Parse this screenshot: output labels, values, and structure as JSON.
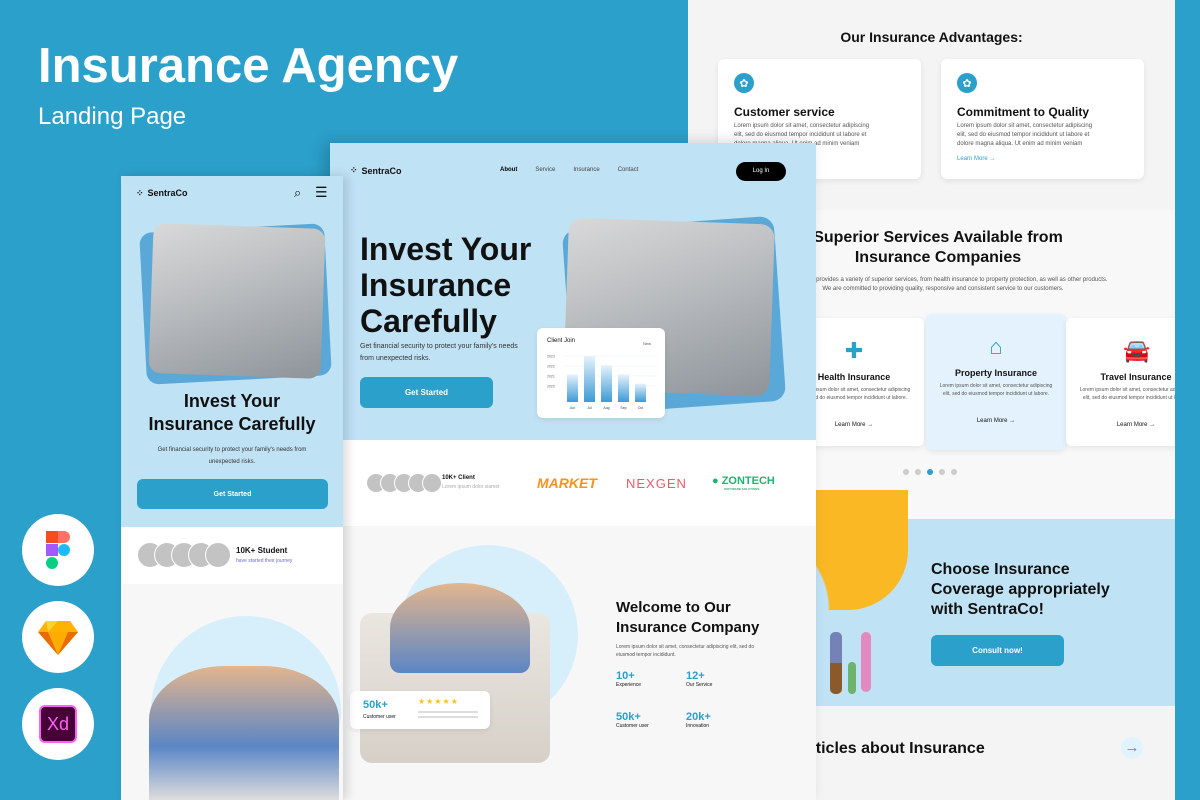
{
  "header": {
    "title": "Insurance Agency",
    "subtitle": "Landing Page"
  },
  "tools": [
    {
      "name": "figma-icon"
    },
    {
      "name": "sketch-icon"
    },
    {
      "name": "xd-icon",
      "label": "Xd"
    }
  ],
  "colors": {
    "brand": "#2ba0cb",
    "hero_bg": "#c0e2f5",
    "panel": "#f4f4f4"
  },
  "right": {
    "advantages_title": "Our Insurance Advantages:",
    "advantages": [
      {
        "title": "Customer service",
        "text": "Lorem ipsum dolor sit amet, consectetur adipiscing elit, sed do eiusmod tempor incididunt ut labore et dolore magna aliqua. Ut enim ad minim veniam"
      },
      {
        "title": "Commitment to Quality",
        "text": "Lorem ipsum dolor sit amet, consectetur adipiscing elit, sed do eiusmod tempor incididunt ut labore et dolore magna aliqua. Ut enim ad minim veniam",
        "link": "Learn More"
      }
    ],
    "services_title": "Superior Services Available from Insurance Companies",
    "services_desc": "Our company provides a variety of superior services, from health insurance to property protection, as well as other products. We are committed to providing quality, responsive and consistent service to our customers.",
    "services": [
      {
        "title": "Health Insurance",
        "text": "Lorem ipsum dolor sit amet, consectetur adipiscing elit, sed do eiusmod tempor incididunt ut labore.",
        "link": "Learn More"
      },
      {
        "title": "Property Insurance",
        "text": "Lorem ipsum dolor sit amet, consectetur adipiscing elit, sed do eiusmod tempor incididunt ut labore.",
        "link": "Learn More"
      },
      {
        "title": "Travel Insurance",
        "text": "Lorem ipsum dolor sit amet, consectetur adipiscing elit, sed do eiusmod tempor incididunt ut labore.",
        "link": "Learn More"
      }
    ],
    "carousel": {
      "count": 5,
      "active": 3
    },
    "cta_title": "Choose Insurance Coverage appropriately with SentraCo!",
    "cta_button": "Consult now!",
    "articles_title": "Articles about Insurance"
  },
  "desktop": {
    "brand": "SentraCo",
    "nav": [
      "About",
      "Service",
      "Insurance",
      "Contact"
    ],
    "login": "Log In",
    "hero_title": "Invest Your Insurance Carefully",
    "hero_text": "Get financial security to protect your family's needs from unexpected risks.",
    "cta": "Get Started",
    "chart": {
      "title": "Client Join",
      "filter": "New",
      "y_ticks": [
        "2023",
        "2022",
        "2021",
        "2020"
      ],
      "categories": [
        "Jun",
        "Jul",
        "Aug",
        "Sep",
        "Oct"
      ],
      "values": [
        0.6,
        1.0,
        0.8,
        0.6,
        0.4
      ]
    },
    "clients": {
      "count": "10K+ Client",
      "text": "Lorem ipsum dolor siamet"
    },
    "logos": [
      "MARKET",
      "NEXGEN",
      "ZONTECH"
    ],
    "logo_sub": "SOFTWARE SOLUTIONS",
    "rating": {
      "value": "50k+",
      "label": "Customer user",
      "stars": 5
    },
    "welcome_title": "Welcome to Our Insurance Company",
    "welcome_text": "Lorem ipsum dolor sit amet, consectetur adipiscing elit, sed do eiusmod tempor incididunt.",
    "stats": [
      {
        "value": "10+",
        "label": "Experience"
      },
      {
        "value": "12+",
        "label": "Our Service"
      },
      {
        "value": "50k+",
        "label": "Customer user"
      },
      {
        "value": "20k+",
        "label": "Innovation"
      }
    ]
  },
  "mobile": {
    "brand": "SentraCo",
    "hero_title": "Invest Your Insurance Carefully",
    "hero_text": "Get financial security to protect your family's needs from unexpected risks.",
    "cta": "Get Started",
    "students": {
      "count": "10K+ Student",
      "text": "have started their journey"
    }
  }
}
